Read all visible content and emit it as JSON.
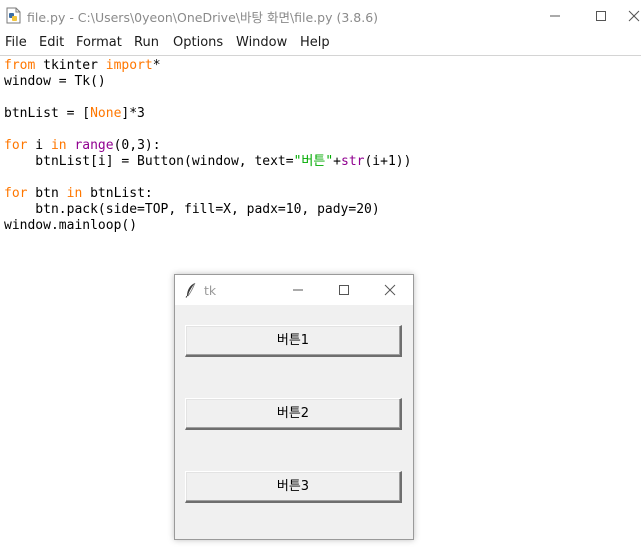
{
  "editor": {
    "title": "file.py - C:\\Users\\0yeon\\OneDrive\\바탕 화면\\file.py (3.8.6)",
    "menu": [
      "File",
      "Edit",
      "Format",
      "Run",
      "Options",
      "Window",
      "Help"
    ],
    "code_lines": [
      [
        [
          "kw",
          "from"
        ],
        [
          "t",
          " tkinter "
        ],
        [
          "kw",
          "import"
        ],
        [
          "t",
          "*"
        ]
      ],
      [
        [
          "t",
          "window = Tk()"
        ]
      ],
      [],
      [
        [
          "t",
          "btnList = ["
        ],
        [
          "kw",
          "None"
        ],
        [
          "t",
          "]*3"
        ]
      ],
      [],
      [
        [
          "kw",
          "for"
        ],
        [
          "t",
          " i "
        ],
        [
          "kw",
          "in"
        ],
        [
          "t",
          " "
        ],
        [
          "bi",
          "range"
        ],
        [
          "t",
          "(0,3):"
        ]
      ],
      [
        [
          "t",
          "    btnList[i] = Button(window, text="
        ],
        [
          "str",
          "\"버튼\""
        ],
        [
          "t",
          "+"
        ],
        [
          "bi",
          "str"
        ],
        [
          "t",
          "(i+1))"
        ]
      ],
      [],
      [
        [
          "kw",
          "for"
        ],
        [
          "t",
          " btn "
        ],
        [
          "kw",
          "in"
        ],
        [
          "t",
          " btnList:"
        ]
      ],
      [
        [
          "t",
          "    btn.pack(side=TOP, fill=X, padx=10, pady=20)"
        ]
      ],
      [
        [
          "t",
          "window.mainloop()"
        ]
      ]
    ]
  },
  "tk_window": {
    "title": "tk",
    "buttons": [
      "버튼1",
      "버튼2",
      "버튼3"
    ]
  },
  "colors": {
    "keyword": "#ff7700",
    "builtin": "#900090",
    "string": "#00aa00"
  },
  "icons": {
    "editor": "python-file-icon",
    "tk": "tk-feather-icon"
  }
}
